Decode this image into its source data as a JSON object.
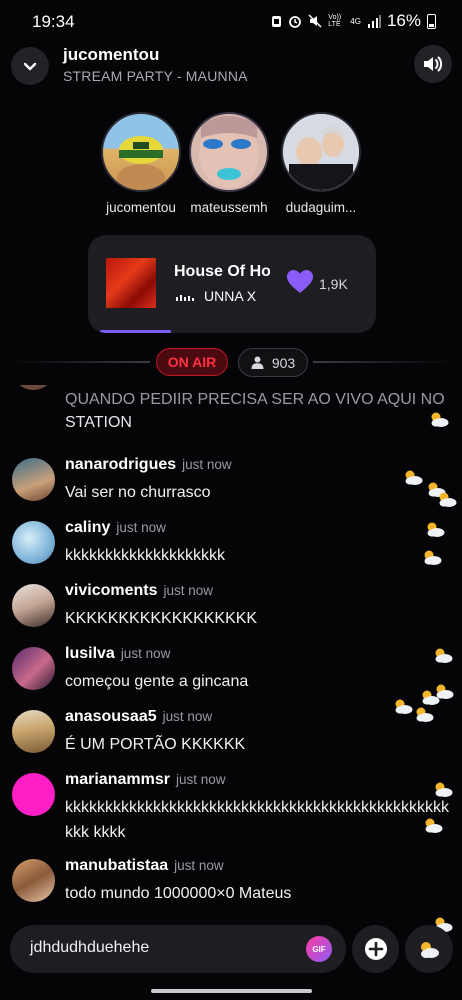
{
  "status_bar": {
    "time": "19:34",
    "network": "4G",
    "volte": "Vo)) LTE",
    "battery": "16%"
  },
  "header": {
    "title": "jucomentou",
    "subtitle": "STREAM PARTY - MAUNNA"
  },
  "participants": [
    {
      "name": "jucomentou"
    },
    {
      "name": "mateussemh"
    },
    {
      "name": "dudaguim..."
    }
  ],
  "player": {
    "song_title": "House Of Ho",
    "artist": "UNNA X",
    "likes": "1,9K",
    "progress": 0.27,
    "accent": "#7c5cf2"
  },
  "live": {
    "on_air": "ON AIR",
    "viewers": "903"
  },
  "chat": {
    "partial": {
      "faded": "QUANDO PEDIIR PRECISA SER AO VIVO AQUI NO",
      "text": "STATION"
    },
    "messages": [
      {
        "user": "nanarodrigues",
        "time": "just now",
        "text": "Vai ser no churrasco"
      },
      {
        "user": "caliny",
        "time": "just now",
        "text": "kkkkkkkkkkkkkkkkkkkk"
      },
      {
        "user": "vivicoments",
        "time": "just now",
        "text": "KKKKKKKKKKKKKKKKKK"
      },
      {
        "user": "lusilva",
        "time": "just now",
        "text": "começou  gente a gincana"
      },
      {
        "user": "anasousaa5",
        "time": "just now",
        "text": "É UM PORTÃO KKKKKK"
      },
      {
        "user": "marianammsr",
        "time": "just now",
        "text": "kkkkkkkkkkkkkkkkkkkkkkkkkkkkkkkkkkkkkkkkkkkkkkkkkkk kkkk"
      },
      {
        "user": "manubatistaa",
        "time": "just now",
        "text": "todo mundo 1000000×0 Mateus"
      }
    ]
  },
  "composer": {
    "value": "jdhdudhduehehe",
    "gif_label": "GIF"
  },
  "colors": {
    "on_air": "#ff2f44",
    "heart": "#8b5cf6",
    "avatar_pink": "#ff1fc4"
  }
}
